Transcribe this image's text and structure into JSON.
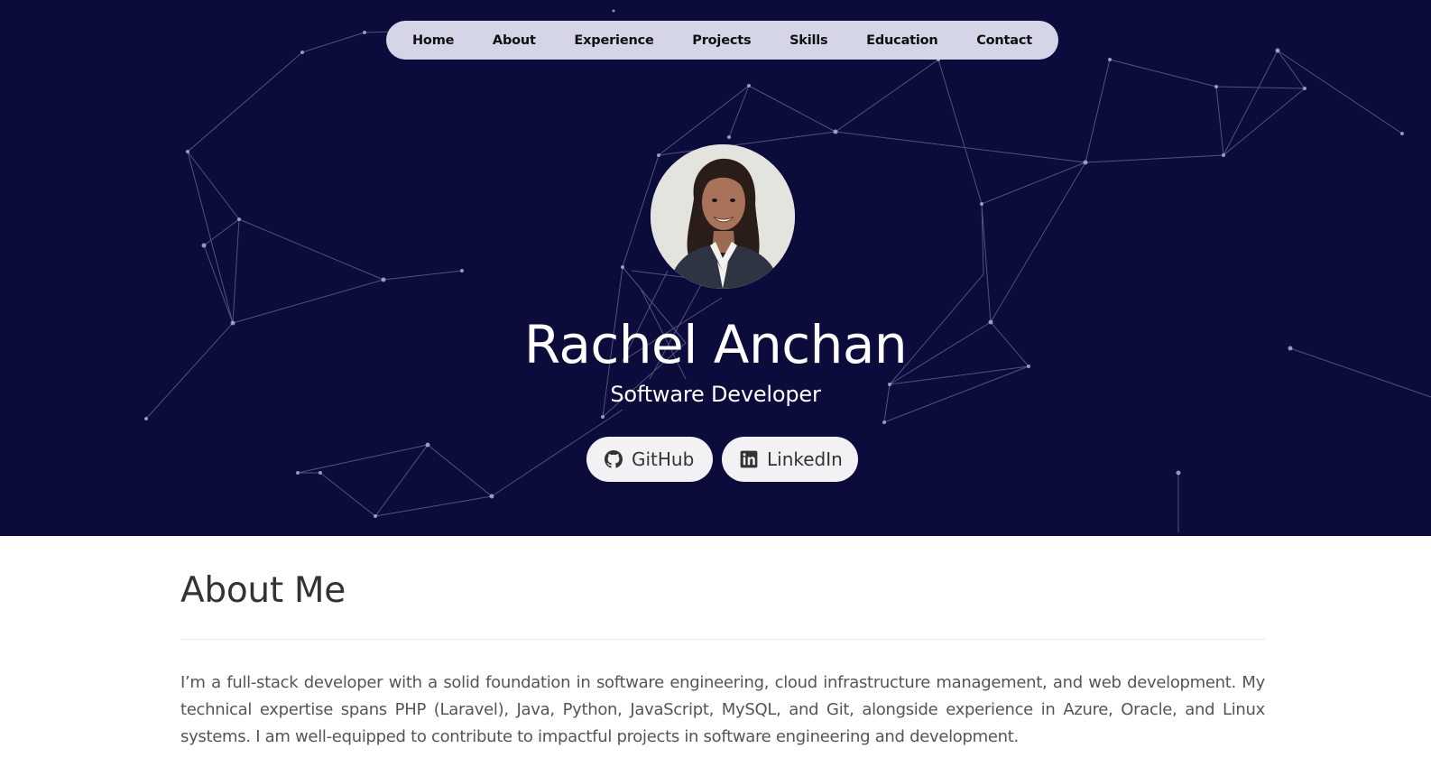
{
  "nav": {
    "items": [
      "Home",
      "About",
      "Experience",
      "Projects",
      "Skills",
      "Education",
      "Contact"
    ]
  },
  "hero": {
    "name": "Rachel Anchan",
    "role": "Software Developer",
    "social": {
      "github_label": "GitHub",
      "linkedin_label": "LinkedIn"
    }
  },
  "about": {
    "title": "About Me",
    "text": "I’m a full-stack developer with a solid foundation in software engineering, cloud infrastructure management, and web development. My technical expertise spans PHP (Laravel), Java, Python, JavaScript, MySQL, and Git, alongside experience in Azure, Oracle, and Linux systems. I am well-equipped to contribute to impactful projects in software engineering and development."
  },
  "icons": {
    "github": "github-icon",
    "linkedin": "linkedin-icon"
  },
  "colors": {
    "hero_background": "#0b0b3c",
    "nav_background": "#d4d5e6",
    "button_background": "#f2f2f4"
  }
}
